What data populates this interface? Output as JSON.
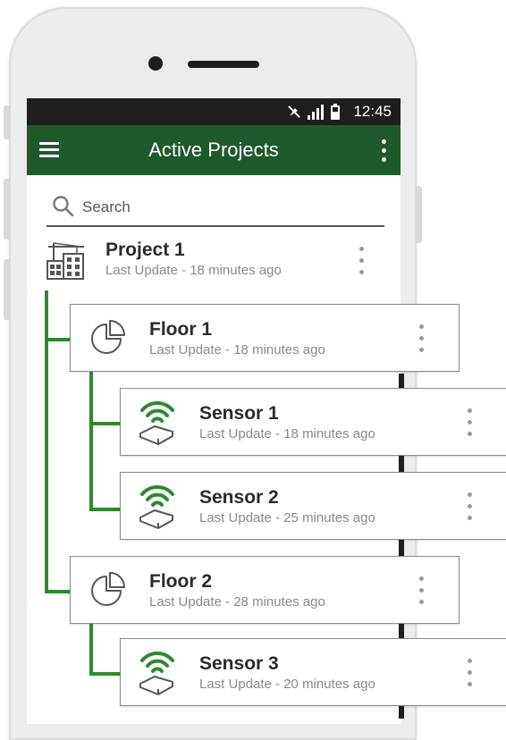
{
  "statusbar": {
    "time": "12:45"
  },
  "appbar": {
    "title": "Active Projects"
  },
  "search": {
    "placeholder": "Search"
  },
  "colors": {
    "brand_green": "#1f5a2c",
    "accent_green": "#2d8a2d",
    "statusbar": "#1e1e1e"
  },
  "tree": [
    {
      "type": "project",
      "icon": "building-icon",
      "title": "Project 1",
      "subtitle": "Last Update - 18 minutes ago"
    },
    {
      "type": "floor",
      "icon": "pie-chart-icon",
      "title": "Floor 1",
      "subtitle": "Last Update - 18 minutes ago"
    },
    {
      "type": "sensor",
      "icon": "wifi-sensor-icon",
      "title": "Sensor 1",
      "subtitle": "Last Update - 18 minutes ago"
    },
    {
      "type": "sensor",
      "icon": "wifi-sensor-icon",
      "title": "Sensor 2",
      "subtitle": "Last Update - 25 minutes ago"
    },
    {
      "type": "floor",
      "icon": "pie-chart-icon",
      "title": "Floor 2",
      "subtitle": "Last Update - 28 minutes ago"
    },
    {
      "type": "sensor",
      "icon": "wifi-sensor-icon",
      "title": "Sensor 3",
      "subtitle": "Last Update - 20 minutes ago"
    }
  ]
}
